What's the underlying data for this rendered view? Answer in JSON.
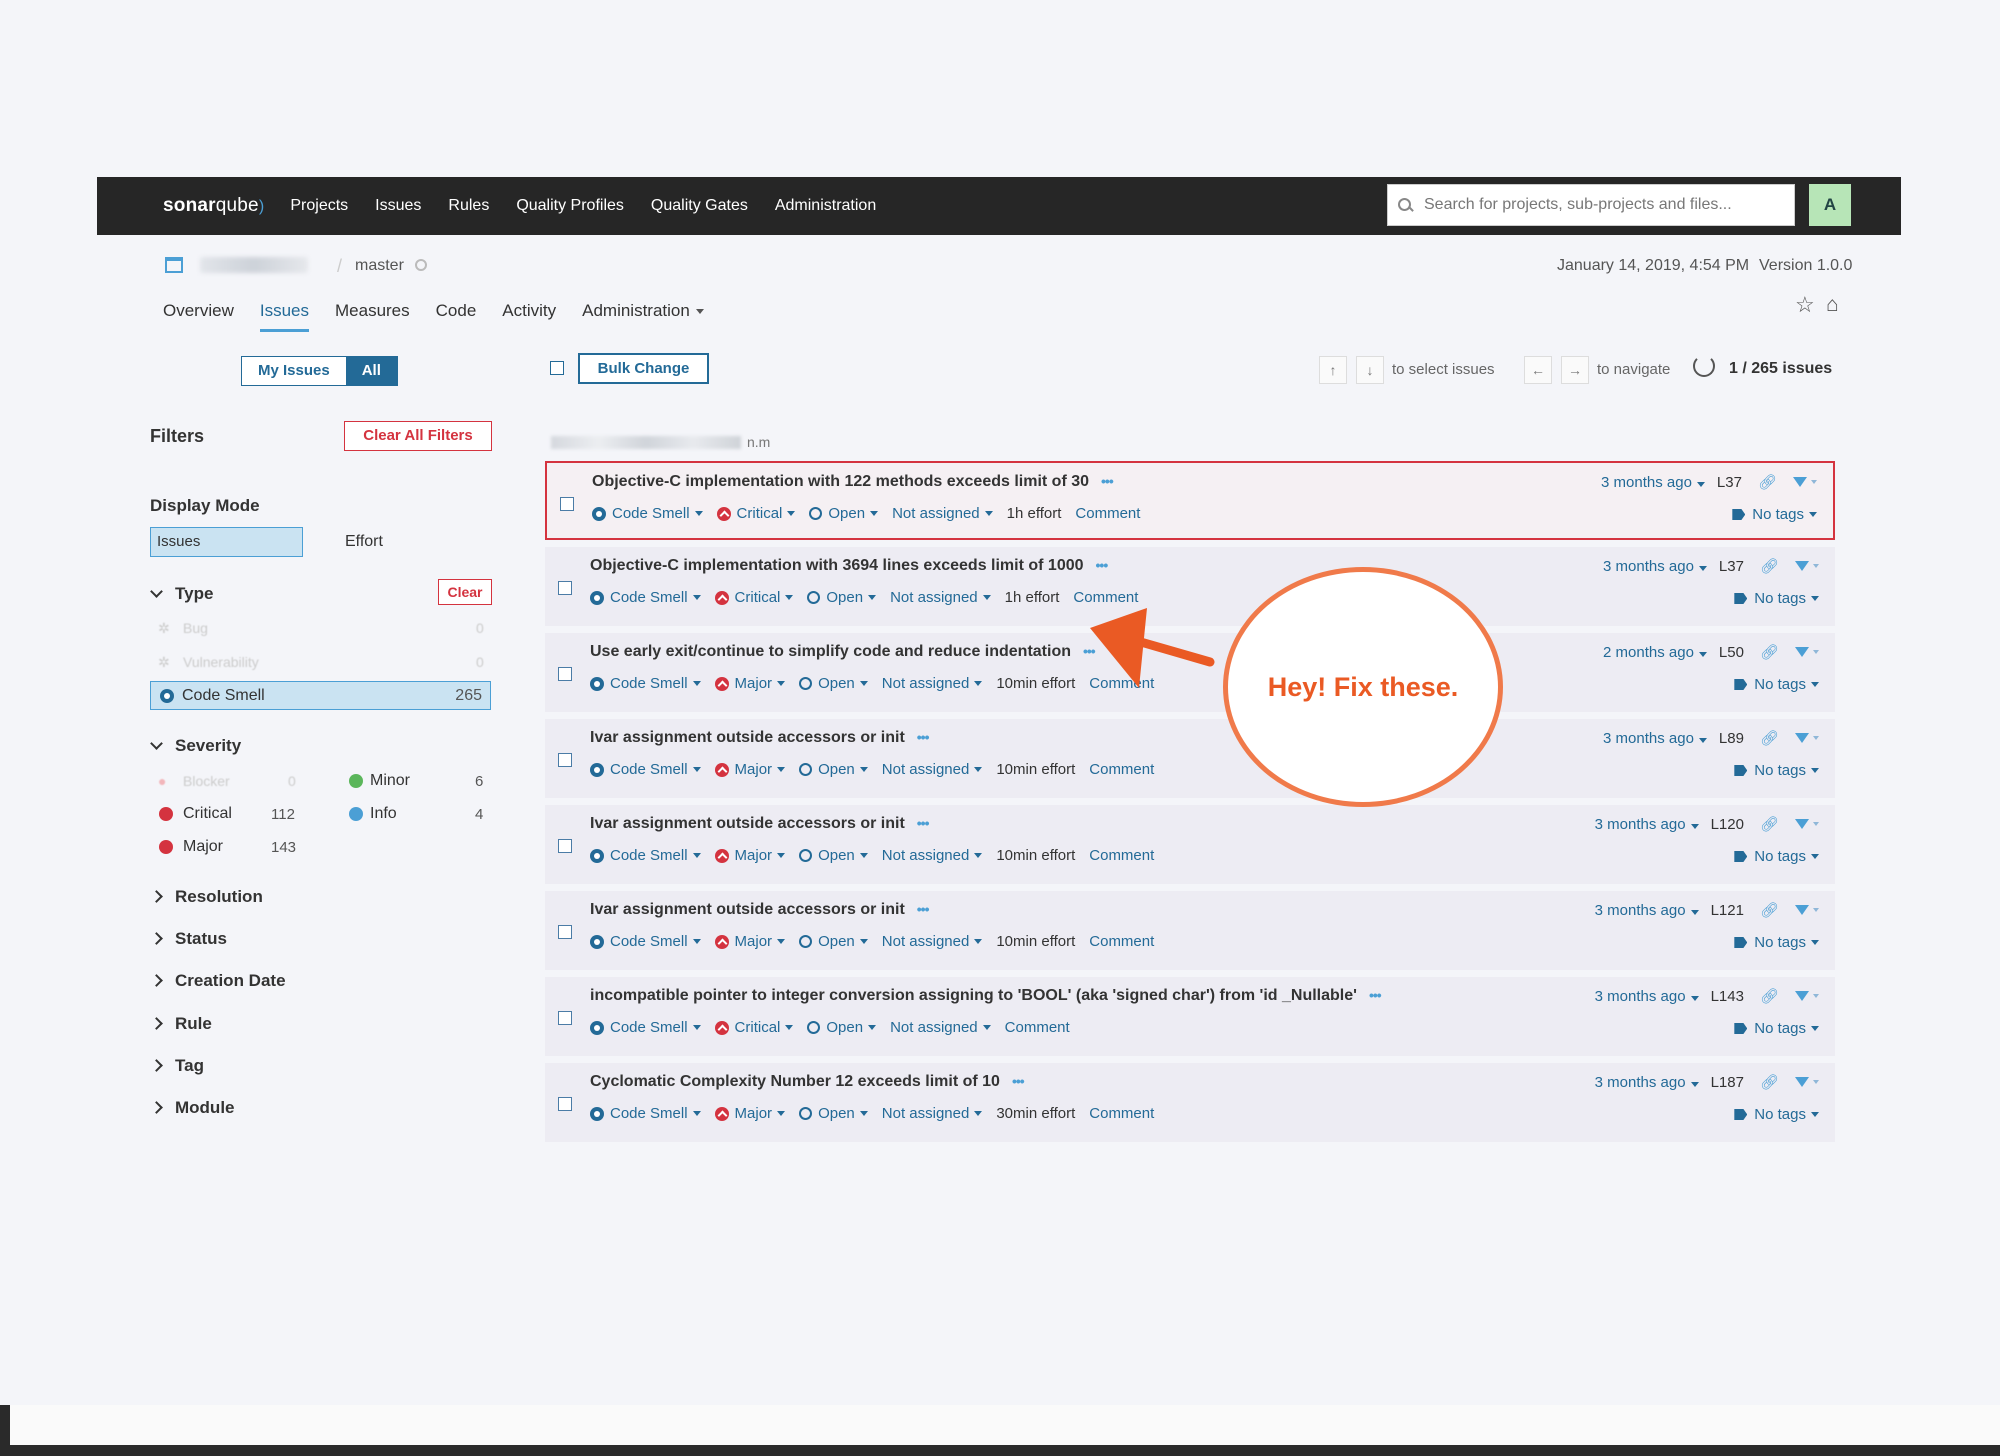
{
  "topnav": {
    "logo_main": "sonar",
    "logo_light": "qube",
    "items": [
      "Projects",
      "Issues",
      "Rules",
      "Quality Profiles",
      "Quality Gates",
      "Administration"
    ],
    "help": "?",
    "search_placeholder": "Search for projects, sub-projects and files...",
    "avatar_initial": "A"
  },
  "component": {
    "branch": "master",
    "analysis_date": "January 14, 2019, 4:54 PM",
    "version": "Version 1.0.0",
    "nav": [
      "Overview",
      "Issues",
      "Measures",
      "Code",
      "Activity",
      "Administration"
    ],
    "active_nav": "Issues"
  },
  "sidebar": {
    "my_issues": "My Issues",
    "all": "All",
    "filters": "Filters",
    "clear_all": "Clear All Filters",
    "display_mode": "Display Mode",
    "mode_issues": "Issues",
    "mode_effort": "Effort",
    "type": {
      "title": "Type",
      "clear": "Clear",
      "bug": "Bug",
      "bug_count": "0",
      "vulnerability": "Vulnerability",
      "vulnerability_count": "0",
      "code_smell": "Code Smell",
      "code_smell_count": "265"
    },
    "severity": {
      "title": "Severity",
      "blocker": "Blocker",
      "blocker_count": "0",
      "critical": "Critical",
      "critical_count": "112",
      "major": "Major",
      "major_count": "143",
      "minor": "Minor",
      "minor_count": "6",
      "info": "Info",
      "info_count": "4"
    },
    "collapsed_facets": [
      "Resolution",
      "Status",
      "Creation Date",
      "Rule",
      "Tag",
      "Module"
    ]
  },
  "toolbar": {
    "bulk_change": "Bulk Change",
    "up_key": "↑",
    "down_key": "↓",
    "select_hint": "to select issues",
    "left_key": "←",
    "right_key": "→",
    "navigate_hint": "to navigate",
    "paging": "1 / 265 issues"
  },
  "file_suffix": "n.m",
  "issues": [
    {
      "message": "Objective-C implementation with 122 methods exceeds limit of 30",
      "type": "Code Smell",
      "severity": "Critical",
      "status": "Open",
      "assignee": "Not assigned",
      "effort": "1h effort",
      "comment": "Comment",
      "age": "3 months ago",
      "line": "L37",
      "tags": "No tags"
    },
    {
      "message": "Objective-C implementation with 3694 lines exceeds limit of 1000",
      "type": "Code Smell",
      "severity": "Critical",
      "status": "Open",
      "assignee": "Not assigned",
      "effort": "1h effort",
      "comment": "Comment",
      "age": "3 months ago",
      "line": "L37",
      "tags": "No tags"
    },
    {
      "message": "Use early exit/continue to simplify code and reduce indentation",
      "type": "Code Smell",
      "severity": "Major",
      "status": "Open",
      "assignee": "Not assigned",
      "effort": "10min effort",
      "comment": "Comment",
      "age": "2 months ago",
      "line": "L50",
      "tags": "No tags"
    },
    {
      "message": "Ivar assignment outside accessors or init",
      "type": "Code Smell",
      "severity": "Major",
      "status": "Open",
      "assignee": "Not assigned",
      "effort": "10min effort",
      "comment": "Comment",
      "age": "3 months ago",
      "line": "L89",
      "tags": "No tags"
    },
    {
      "message": "Ivar assignment outside accessors or init",
      "type": "Code Smell",
      "severity": "Major",
      "status": "Open",
      "assignee": "Not assigned",
      "effort": "10min effort",
      "comment": "Comment",
      "age": "3 months ago",
      "line": "L120",
      "tags": "No tags"
    },
    {
      "message": "Ivar assignment outside accessors or init",
      "type": "Code Smell",
      "severity": "Major",
      "status": "Open",
      "assignee": "Not assigned",
      "effort": "10min effort",
      "comment": "Comment",
      "age": "3 months ago",
      "line": "L121",
      "tags": "No tags"
    },
    {
      "message": "incompatible pointer to integer conversion assigning to 'BOOL' (aka 'signed char') from 'id _Nullable'",
      "type": "Code Smell",
      "severity": "Critical",
      "status": "Open",
      "assignee": "Not assigned",
      "effort": "",
      "comment": "Comment",
      "age": "3 months ago",
      "line": "L143",
      "tags": "No tags"
    },
    {
      "message": "Cyclomatic Complexity Number 12 exceeds limit of 10",
      "type": "Code Smell",
      "severity": "Major",
      "status": "Open",
      "assignee": "Not assigned",
      "effort": "30min effort",
      "comment": "Comment",
      "age": "3 months ago",
      "line": "L187",
      "tags": "No tags"
    }
  ],
  "annotation": {
    "text": "Hey! Fix these.",
    "color": "#ea5a24"
  },
  "colors": {
    "nav_bg": "#262626",
    "link": "#236a97",
    "accent": "#4b9fd5",
    "danger": "#d4333f"
  }
}
